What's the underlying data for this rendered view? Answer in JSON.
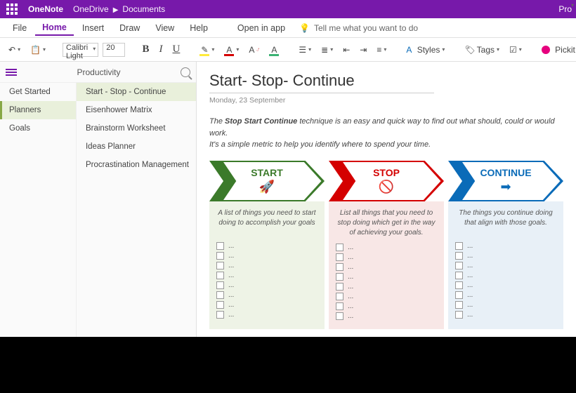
{
  "title": {
    "app": "OneNote",
    "crumb1": "OneDrive",
    "crumb2": "Documents",
    "right": "Pro"
  },
  "menu": {
    "file": "File",
    "home": "Home",
    "insert": "Insert",
    "draw": "Draw",
    "view": "View",
    "help": "Help",
    "open": "Open in app",
    "tell": "Tell me what you want to do"
  },
  "toolbar": {
    "font": "Calibri Light",
    "size": "20",
    "styles": "Styles",
    "tags": "Tags",
    "pickit": "Pickit"
  },
  "nav": {
    "notebook": "Productivity",
    "sections": [
      {
        "label": "Get Started"
      },
      {
        "label": "Planners"
      },
      {
        "label": "Goals"
      }
    ],
    "sel_section": 1,
    "pages": [
      {
        "label": "Start - Stop - Continue"
      },
      {
        "label": "Eisenhower Matrix"
      },
      {
        "label": "Brainstorm Worksheet"
      },
      {
        "label": "Ideas Planner"
      },
      {
        "label": "Procrastination Management"
      }
    ],
    "sel_page": 0
  },
  "page": {
    "title": "Start- Stop- Continue",
    "date": "Monday, 23 September",
    "intro_prefix": "The ",
    "intro_bold": "Stop Start Continue",
    "intro_rest": " technique is an easy and quick way to find out what should, could or would work.",
    "intro_line2": "It's a simple metric to help you identify where to spend your time.",
    "cols": {
      "start": {
        "label": "START",
        "desc": "A list of things you need to start doing to accomplish your goals",
        "color": "#3b7a2a"
      },
      "stop": {
        "label": "STOP",
        "desc": "List all things that you need to stop doing which get in the way of achieving your goals.",
        "color": "#d40000"
      },
      "continue": {
        "label": "CONTINUE",
        "desc": "The things you continue doing that align with those goals.",
        "color": "#0a6bb8"
      }
    },
    "placeholder": "...",
    "rows": 8
  }
}
